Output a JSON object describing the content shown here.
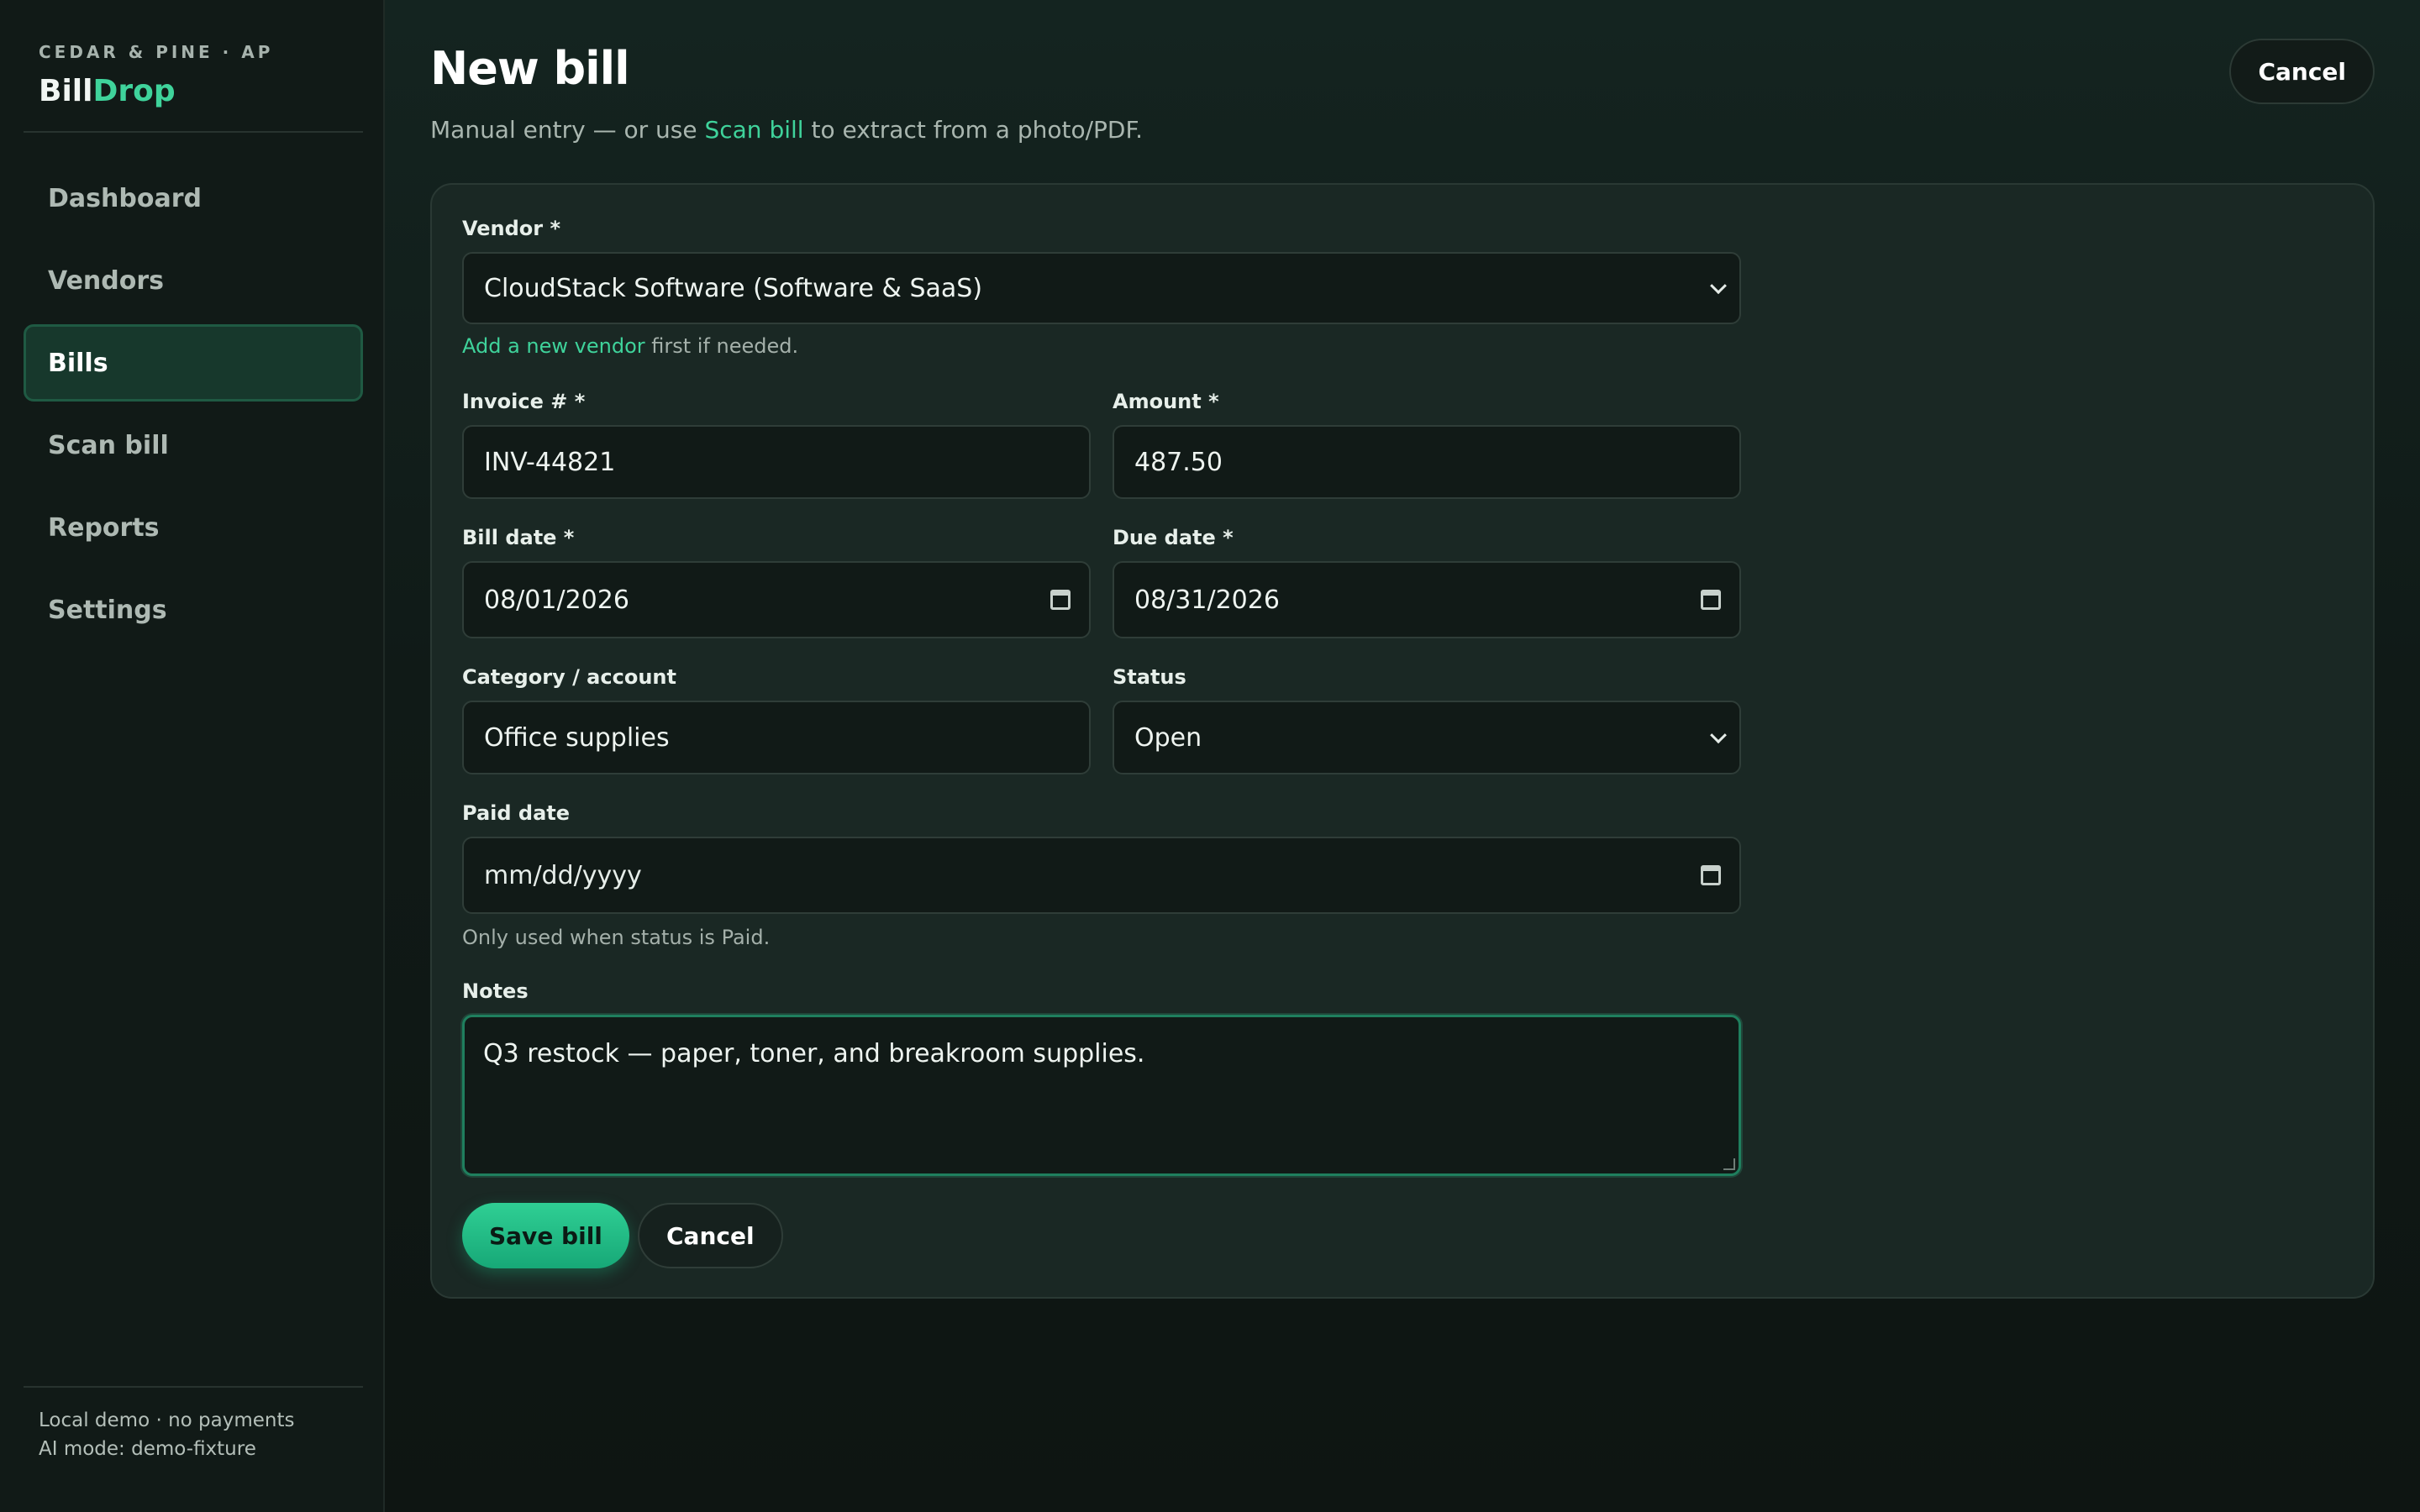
{
  "brand": {
    "org": "CEDAR & PINE · AP",
    "name_part1": "Bill",
    "name_part2": "Drop"
  },
  "sidebar": {
    "items": [
      {
        "label": "Dashboard",
        "active": false
      },
      {
        "label": "Vendors",
        "active": false
      },
      {
        "label": "Bills",
        "active": true
      },
      {
        "label": "Scan bill",
        "active": false
      },
      {
        "label": "Reports",
        "active": false
      },
      {
        "label": "Settings",
        "active": false
      }
    ],
    "footer": {
      "line1": "Local demo · no payments",
      "line2": "AI mode: demo-fixture"
    }
  },
  "header": {
    "title": "New bill",
    "subtitle_prefix": "Manual entry — or use ",
    "subtitle_link": "Scan bill",
    "subtitle_suffix": " to extract from a photo/PDF.",
    "cancel_label": "Cancel"
  },
  "form": {
    "vendor": {
      "label": "Vendor *",
      "value": "CloudStack Software (Software & SaaS)",
      "hint_link": "Add a new vendor",
      "hint_suffix": " first if needed."
    },
    "invoice": {
      "label": "Invoice # *",
      "value": "INV-44821"
    },
    "amount": {
      "label": "Amount *",
      "value": "487.50"
    },
    "bill_date": {
      "label": "Bill date *",
      "value": "08/01/2026"
    },
    "due_date": {
      "label": "Due date *",
      "value": "08/31/2026"
    },
    "category": {
      "label": "Category / account",
      "value": "Office supplies"
    },
    "status": {
      "label": "Status",
      "value": "Open"
    },
    "paid_date": {
      "label": "Paid date",
      "placeholder": "mm/dd/yyyy",
      "hint": "Only used when status is Paid."
    },
    "notes": {
      "label": "Notes",
      "value": "Q3 restock — paper, toner, and breakroom supplies."
    },
    "save_label": "Save bill",
    "cancel_label": "Cancel"
  },
  "colors": {
    "accent": "#3fd39b",
    "background": "#0f1614",
    "card": "#1a2824",
    "active_nav": "#17382c"
  },
  "icons": {
    "date_picker": "calendar-icon",
    "select": "chevron-down-icon"
  }
}
